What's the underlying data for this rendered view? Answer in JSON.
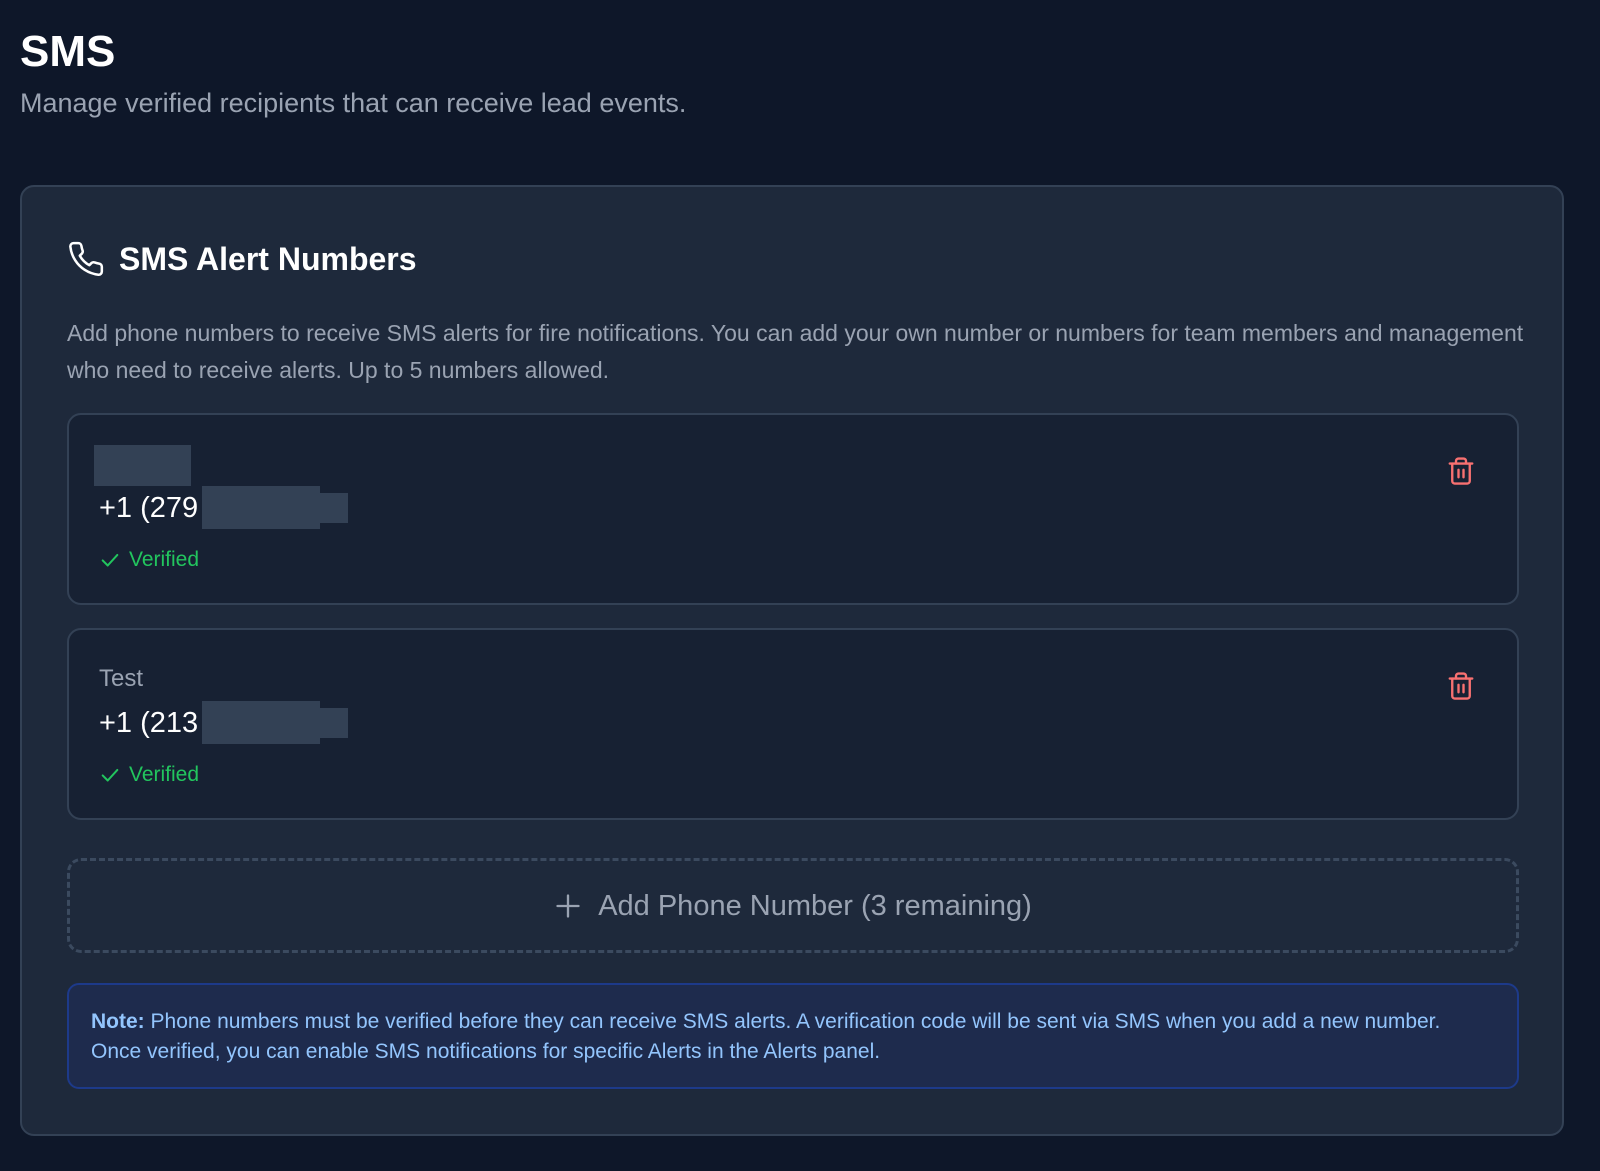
{
  "page": {
    "title": "SMS",
    "subtitle": "Manage verified recipients that can receive lead events."
  },
  "card": {
    "icon": "phone-icon",
    "title": "SMS Alert Numbers",
    "description": "Add phone numbers to receive SMS alerts for fire notifications. You can add your own number or numbers for team members and management who need to receive alerts. Up to 5 numbers allowed."
  },
  "numbers": [
    {
      "label": "",
      "label_redacted": true,
      "number": "+1 (279",
      "status": "Verified"
    },
    {
      "label": "Test",
      "label_redacted": false,
      "number": "+1 (213",
      "status": "Verified"
    }
  ],
  "add_button": {
    "label": "Add Phone Number (3 remaining)"
  },
  "note": {
    "label": "Note:",
    "text": " Phone numbers must be verified before they can receive SMS alerts. A verification code will be sent via SMS when you add a new number. Once verified, you can enable SMS notifications for specific Alerts in the Alerts panel."
  },
  "colors": {
    "background": "#0e1729",
    "card": "#1e293b",
    "entry": "#172133",
    "verified": "#22c55e",
    "delete": "#f87171",
    "note_text": "#93c5fd"
  }
}
